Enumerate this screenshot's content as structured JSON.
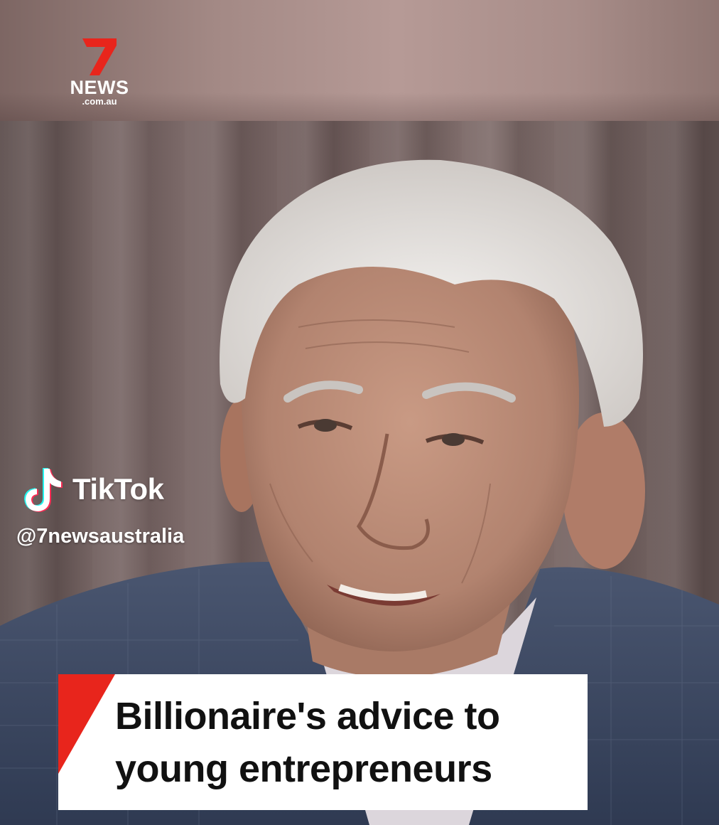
{
  "logo": {
    "brand": "NEWS",
    "domain": ".com.au",
    "numeral": "7",
    "accent_color": "#e8251c"
  },
  "watermark": {
    "platform": "TikTok",
    "handle": "@7newsaustralia",
    "icon": "tiktok-icon"
  },
  "caption": {
    "line1": "Billionaire's advice to",
    "line2": "young entrepreneurs",
    "accent_color": "#e8251c"
  }
}
